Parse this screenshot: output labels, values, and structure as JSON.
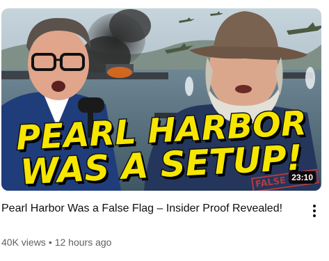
{
  "video": {
    "thumbnail": {
      "headline_line1": "PEARL HARBOR",
      "headline_line2": "WAS A SETUP!",
      "stamp_text": "FALSE FLAG",
      "duration": "23:10"
    },
    "title": "Pearl Harbor Was a False Flag – Insider Proof Revealed!",
    "views": "40K views",
    "separator": "•",
    "age": "12 hours ago",
    "more_icon": "vertical-ellipsis-icon"
  },
  "colors": {
    "headline": "#f6e600",
    "title": "#0f0f0f",
    "meta": "#606060"
  }
}
